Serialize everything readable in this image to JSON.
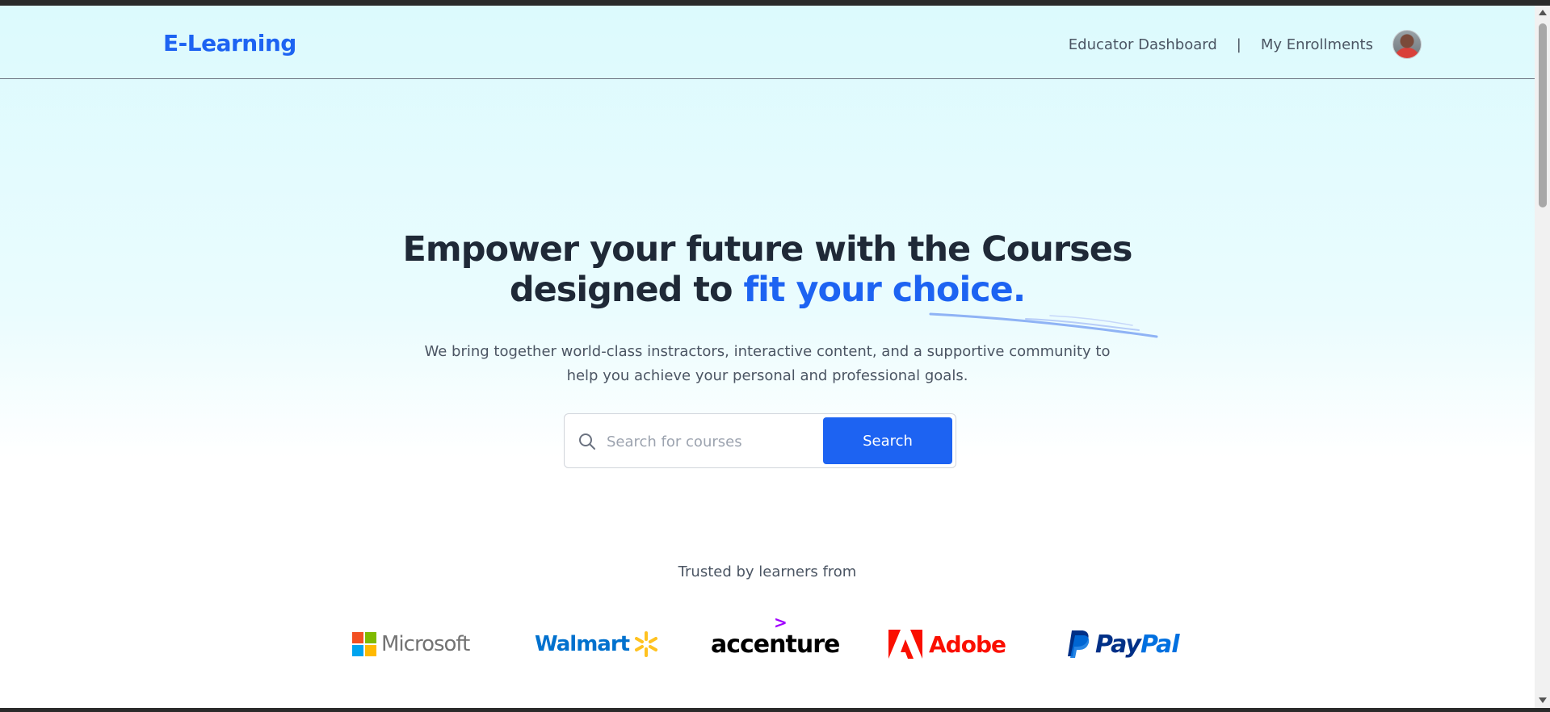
{
  "header": {
    "logo": "E-Learning",
    "nav": {
      "educator_dashboard": "Educator Dashboard",
      "separator": "|",
      "my_enrollments": "My Enrollments"
    },
    "avatar_icon": "user-avatar"
  },
  "hero": {
    "title_line1": "Empower your future with the Courses",
    "title_line2_prefix": "designed to ",
    "title_line2_accent": "fit your choice.",
    "subtitle_line1": "We bring together world-class instractors, interactive content, and a supportive community to",
    "subtitle_line2": "help you achieve your personal and professional goals."
  },
  "search": {
    "placeholder": "Search for courses",
    "value": "",
    "button_label": "Search",
    "icon": "search-icon"
  },
  "trusted": {
    "heading": "Trusted by learners from",
    "companies": [
      "Microsoft",
      "Walmart",
      "accenture",
      "Adobe",
      "PayPal"
    ]
  },
  "colors": {
    "accent": "#1d63f2",
    "text_dark": "#1f2937",
    "text_muted": "#4b5563",
    "hero_bg": "#dcfafd"
  }
}
